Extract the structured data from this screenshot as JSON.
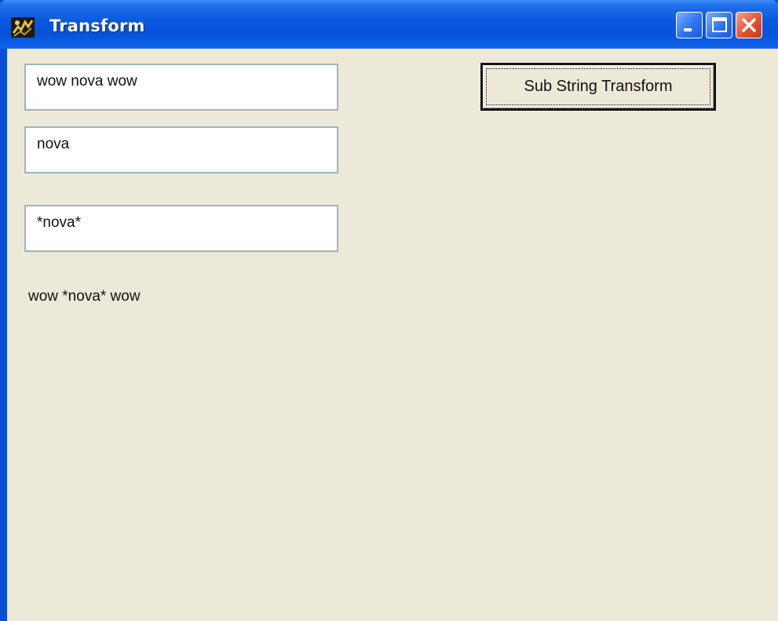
{
  "window": {
    "title": "Transform"
  },
  "fields": {
    "source_text": "wow nova wow",
    "search_text": "nova",
    "replacement_text": "*nova*"
  },
  "result": {
    "text": "wow *nova* wow"
  },
  "actions": {
    "transform_label": "Sub String Transform"
  },
  "icons": {
    "app": "java-app-icon",
    "minimize": "minimize-icon",
    "maximize": "maximize-icon",
    "close": "close-icon"
  },
  "colors": {
    "titlebar": "#0858e0",
    "client_background": "#ece9d8",
    "close_button": "#e2542f"
  }
}
